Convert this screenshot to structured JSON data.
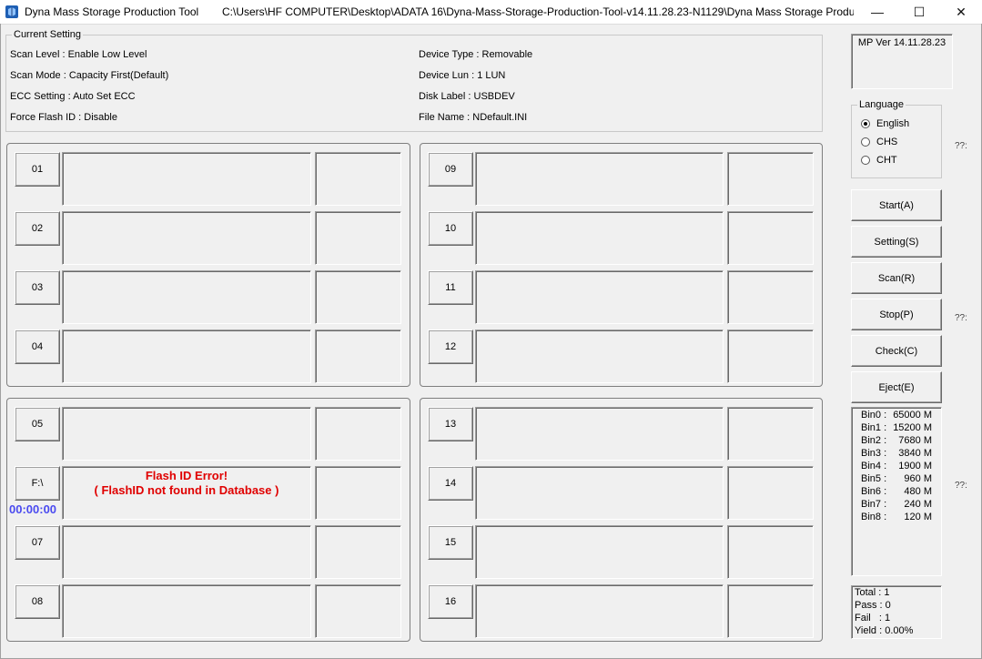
{
  "window": {
    "app_title": "Dyna Mass Storage Production Tool",
    "path_title": "C:\\Users\\HF COMPUTER\\Desktop\\ADATA 16\\Dyna-Mass-Storage-Production-Tool-v14.11.28.23-N1129\\Dyna Mass Storage Produc...",
    "minimize": "—",
    "maximize": "☐",
    "close": "✕"
  },
  "current_setting": {
    "title": "Current Setting",
    "scan_level": "Scan Level : Enable Low Level",
    "scan_mode": "Scan Mode : Capacity First(Default)",
    "ecc_setting": "ECC Setting : Auto Set ECC",
    "force_flash_id": "Force Flash ID : Disable",
    "device_type": "Device Type : Removable",
    "device_lun": "Device Lun : 1 LUN",
    "disk_label": "Disk Label : USBDEV",
    "file_name": "File Name : NDefault.INI"
  },
  "ports": {
    "p01": "01",
    "p02": "02",
    "p03": "03",
    "p04": "04",
    "p05": "05",
    "p06": "F:\\",
    "p07": "07",
    "p08": "08",
    "p09": "09",
    "p10": "10",
    "p11": "11",
    "p12": "12",
    "p13": "13",
    "p14": "14",
    "p15": "15",
    "p16": "16"
  },
  "port6_status": {
    "timer": "00:00:00",
    "error_line1": "Flash ID Error!",
    "error_line2": "( FlashID not found in Database )",
    "error_color": "#e00000",
    "timer_color": "#4a4af0"
  },
  "version": "MP Ver 14.11.28.23",
  "language": {
    "title": "Language",
    "options": [
      "English",
      "CHS",
      "CHT"
    ],
    "selected": "English"
  },
  "side_marks": {
    "m1": "??:",
    "m2": "??:",
    "m3": "??:"
  },
  "buttons": {
    "start": "Start(A)",
    "setting": "Setting(S)",
    "scan": "Scan(R)",
    "stop": "Stop(P)",
    "check": "Check(C)",
    "eject": "Eject(E)"
  },
  "bins": [
    {
      "name": "Bin0 :",
      "value": "65000 M"
    },
    {
      "name": "Bin1 :",
      "value": "15200 M"
    },
    {
      "name": "Bin2 :",
      "value": "7680 M"
    },
    {
      "name": "Bin3 :",
      "value": "3840 M"
    },
    {
      "name": "Bin4 :",
      "value": "1900 M"
    },
    {
      "name": "Bin5 :",
      "value": "960 M"
    },
    {
      "name": "Bin6 :",
      "value": "480 M"
    },
    {
      "name": "Bin7 :",
      "value": "240 M"
    },
    {
      "name": "Bin8 :",
      "value": "120 M"
    }
  ],
  "stats": {
    "total": "Total : 1",
    "pass": "Pass : 0",
    "fail": "Fail   : 1",
    "yield": "Yield : 0.00%"
  }
}
